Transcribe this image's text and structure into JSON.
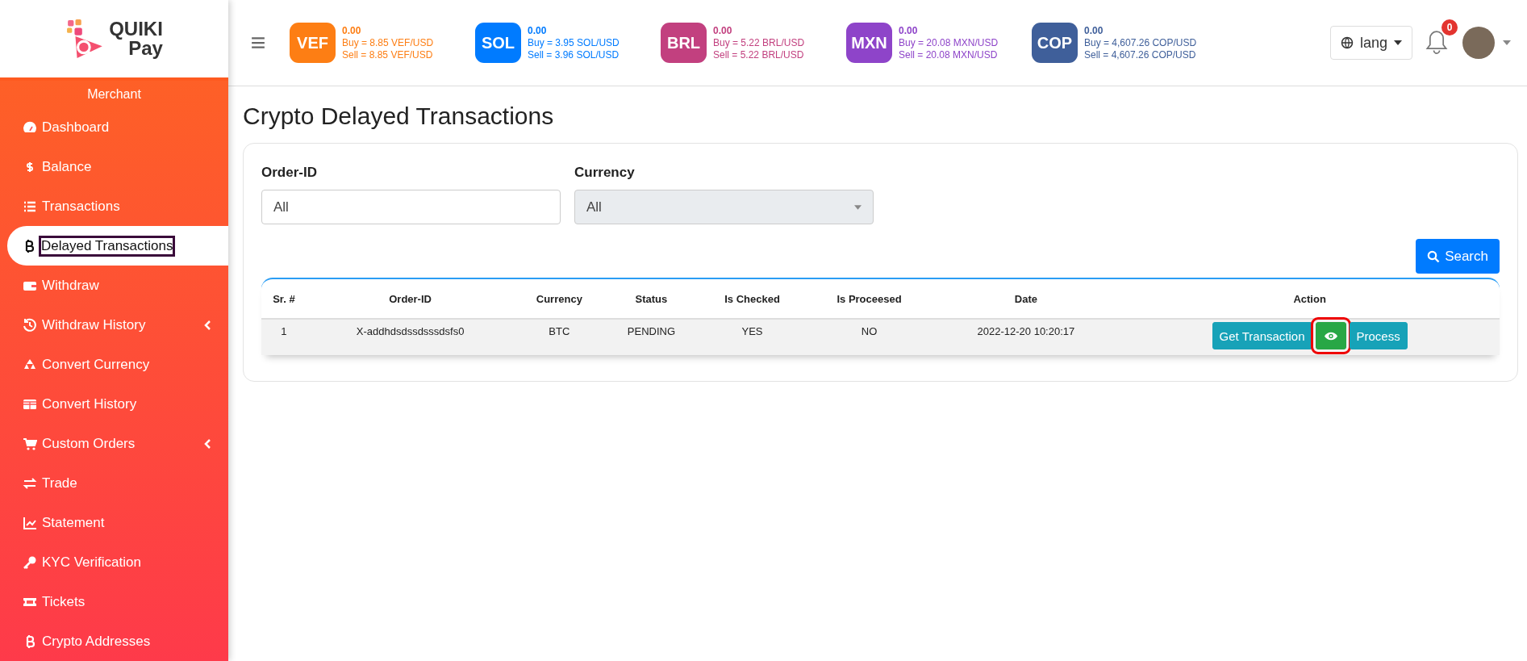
{
  "brand": {
    "line_1": "QUIKI",
    "line_2": "Pay"
  },
  "rates": [
    {
      "code": "VEF",
      "color": "#fd7e14",
      "amount": "0.00",
      "buy": "Buy = 8.85 VEF/USD",
      "sell": "Sell = 8.85 VEF/USD"
    },
    {
      "code": "SOL",
      "color": "#007bff",
      "amount": "0.00",
      "buy": "Buy = 3.95 SOL/USD",
      "sell": "Sell = 3.96 SOL/USD"
    },
    {
      "code": "BRL",
      "color": "#c2407f",
      "amount": "0.00",
      "buy": "Buy = 5.22 BRL/USD",
      "sell": "Sell = 5.22 BRL/USD"
    },
    {
      "code": "MXN",
      "color": "#8e44c9",
      "amount": "0.00",
      "buy": "Buy = 20.08 MXN/USD",
      "sell": "Sell = 20.08 MXN/USD"
    },
    {
      "code": "COP",
      "color": "#3f5f9a",
      "amount": "0.00",
      "buy": "Buy = 4,607.26 COP/USD",
      "sell": "Sell = 4,607.26 COP/USD"
    }
  ],
  "language": {
    "label": "lang"
  },
  "notifications": {
    "count": "0"
  },
  "sidebar": {
    "heading": "Merchant",
    "items": [
      {
        "label": "Dashboard",
        "kind": "gauge",
        "selected": false,
        "submenu": false
      },
      {
        "label": "Balance",
        "kind": "dollar",
        "selected": false,
        "submenu": false
      },
      {
        "label": "Transactions",
        "kind": "list",
        "selected": false,
        "submenu": false
      },
      {
        "label": "Delayed Transactions",
        "kind": "bitcoin",
        "selected": true,
        "submenu": false
      },
      {
        "label": "Withdraw",
        "kind": "wallet",
        "selected": false,
        "submenu": false
      },
      {
        "label": "Withdraw History",
        "kind": "history",
        "selected": false,
        "submenu": true
      },
      {
        "label": "Convert Currency",
        "kind": "recycle",
        "selected": false,
        "submenu": false
      },
      {
        "label": "Convert History",
        "kind": "table",
        "selected": false,
        "submenu": false
      },
      {
        "label": "Custom Orders",
        "kind": "cart",
        "selected": false,
        "submenu": true
      },
      {
        "label": "Trade",
        "kind": "exchange",
        "selected": false,
        "submenu": false
      },
      {
        "label": "Statement",
        "kind": "chart",
        "selected": false,
        "submenu": false
      },
      {
        "label": "KYC Verification",
        "kind": "key",
        "selected": false,
        "submenu": false
      },
      {
        "label": "Tickets",
        "kind": "ticket",
        "selected": false,
        "submenu": false
      },
      {
        "label": "Crypto Addresses",
        "kind": "bitcoin",
        "selected": false,
        "submenu": false
      }
    ]
  },
  "page_title": "Crypto Delayed Transactions",
  "filters": [
    {
      "kind": "input",
      "label": "Order-ID",
      "value": "All"
    },
    {
      "kind": "select",
      "label": "Currency",
      "value": "All"
    }
  ],
  "search_button": "Search",
  "table": {
    "columns": [
      "Sr. #",
      "Order-ID",
      "Currency",
      "Status",
      "Is Checked",
      "Is Proceesed",
      "Date",
      "Action"
    ],
    "rows": [
      {
        "cells": [
          "1",
          "X-addhdsdssdsssdsfs0",
          "BTC",
          "PENDING",
          "YES",
          "NO",
          "2022-12-20 10:20:17"
        ],
        "actions": [
          {
            "kind": "text",
            "label": "Get Transaction",
            "highlighted": false
          },
          {
            "kind": "view",
            "highlighted": true
          },
          {
            "kind": "text",
            "label": "Process",
            "highlighted": false
          }
        ]
      }
    ]
  }
}
